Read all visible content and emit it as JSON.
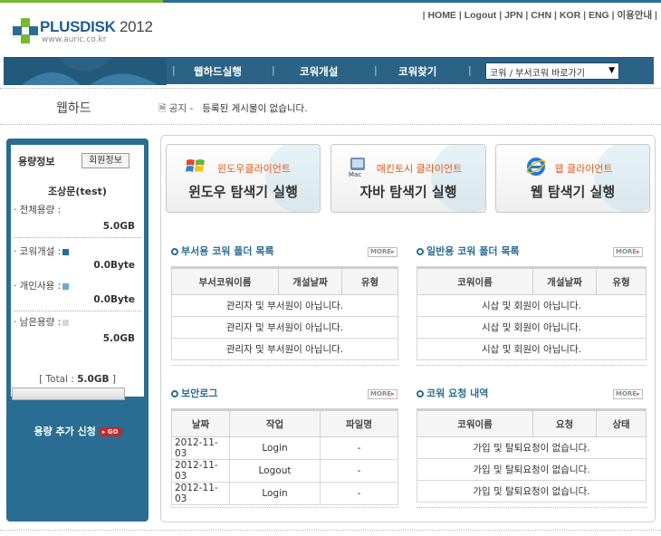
{
  "header": {
    "logo_brand": "PLUSDISK",
    "logo_year": "2012",
    "logo_url": "www.auric.co.kr",
    "top_links": [
      "HOME",
      "Logout",
      "JPN",
      "CHN",
      "KOR",
      "ENG",
      "이용안내"
    ]
  },
  "nav": {
    "items": [
      "웹하드실행",
      "코워개설",
      "코워찾기"
    ],
    "select_value": "코워 / 부서코워 바로가기"
  },
  "page": {
    "section_title": "웹하드",
    "notice_label": "공지 -",
    "notice_text": "등록된 게시물이 없습니다."
  },
  "sidebar": {
    "title": "용량정보",
    "member_button": "회원정보",
    "user_name": "조상문(test)",
    "total_label": "· 전체용량 :",
    "total_value": "5.0GB",
    "cowork_label": "· 코워개설 :",
    "cowork_value": "0.0Byte",
    "personal_label": "· 개인사용 :",
    "personal_value": "0.0Byte",
    "remain_label": "· 남은용량 :",
    "remain_value": "5.0GB",
    "total_summary_prefix": "[ Total : ",
    "total_summary_value": "5.0GB",
    "total_summary_suffix": " ]",
    "add_request": "용량 추가 신청",
    "go_label": "▸ GO",
    "usage_fraction": 0.0
  },
  "launchers": [
    {
      "small": "윈도우클라이언트",
      "big": "윈도우 탐색기 실행",
      "icon": "windows-icon"
    },
    {
      "small": "매킨토시 클라이언트",
      "big": "자바 탐색기 실행",
      "icon": "mac-icon"
    },
    {
      "small": "웹 클라이언트",
      "big": "웹 탐색기 실행",
      "icon": "ie-icon"
    }
  ],
  "dept_folders": {
    "title": "부서용 코워 폴더 목록",
    "more": "MORE",
    "columns": [
      "부서코워이름",
      "개설날짜",
      "유형"
    ],
    "rows": [
      "관리자 및 부서원이 아닙니다.",
      "관리자 및 부서원이 아닙니다.",
      "관리자 및 부서원이 아닙니다."
    ]
  },
  "general_folders": {
    "title": "일반용 코워 폴더 목록",
    "more": "MORE",
    "columns": [
      "코워이름",
      "개설날짜",
      "유형"
    ],
    "rows": [
      "시삽 및 회원이 아닙니다.",
      "시삽 및 회원이 아닙니다.",
      "시삽 및 회원이 아닙니다."
    ]
  },
  "security_log": {
    "title": "보안로그",
    "more": "MORE",
    "columns": [
      "날짜",
      "작업",
      "파일명"
    ],
    "rows": [
      {
        "date": "2012-11-03",
        "action": "Login",
        "file": "-"
      },
      {
        "date": "2012-11-03",
        "action": "Logout",
        "file": "-"
      },
      {
        "date": "2012-11-03",
        "action": "Login",
        "file": "-"
      }
    ]
  },
  "cowork_requests": {
    "title": "코워 요청 내역",
    "more": "MORE",
    "columns": [
      "코워이름",
      "요청",
      "상태"
    ],
    "rows": [
      "가입 및 탈퇴요청이 없습니다.",
      "가입 및 탈퇴요청이 없습니다.",
      "가입 및 탈퇴요청이 없습니다."
    ]
  },
  "colors": {
    "brand_blue": "#2a6d93",
    "accent_green": "#78b832",
    "accent_orange": "#e05a1e"
  }
}
